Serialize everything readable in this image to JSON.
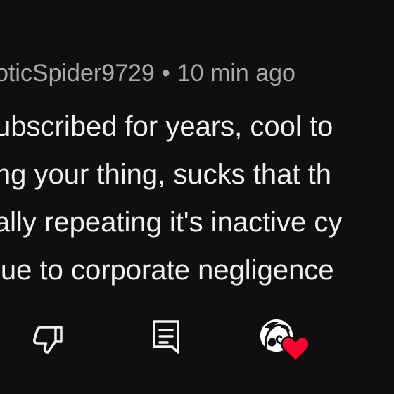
{
  "comment": {
    "author": "oticSpider9729",
    "separator": "•",
    "time": "10 min ago",
    "lines": [
      "ubscribed for years, cool to",
      "ing your thing, sucks that th",
      "ially repeating it's inactive cy",
      "lue to corporate negligence"
    ]
  },
  "actions": {
    "dislike_icon": "thumbs-down-icon",
    "reply_icon": "reply-comment-icon",
    "heart_color": "#ff0033",
    "avatar_icon": "creator-avatar-icon"
  },
  "colors": {
    "background": "#0f0f0f",
    "text": "#f1f1f1",
    "meta": "#aaaaaa"
  }
}
